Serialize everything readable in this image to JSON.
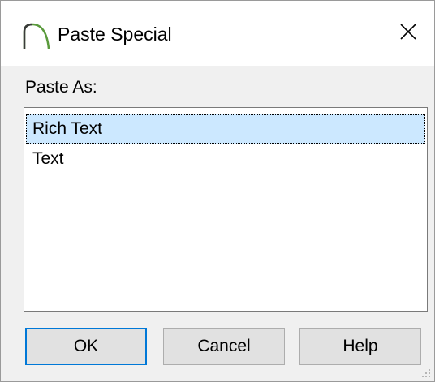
{
  "window": {
    "title": "Paste Special",
    "app_icon": "arch-icon",
    "close_icon": "close-icon"
  },
  "form": {
    "paste_as_label": "Paste As:",
    "options": [
      "Rich Text",
      "Text"
    ],
    "selected_option": "Rich Text"
  },
  "buttons": {
    "ok": "OK",
    "cancel": "Cancel",
    "help": "Help"
  },
  "colors": {
    "selection": "#cce8ff",
    "default_button_border": "#0078d7",
    "arch_icon": "#5a9a3c"
  }
}
